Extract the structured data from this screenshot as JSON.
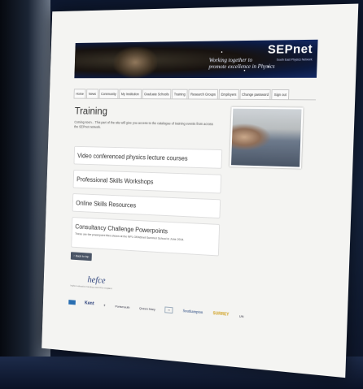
{
  "banner": {
    "logo": "SEPnet",
    "logo_sub": "South East Physics Network",
    "tagline_1": "Working together to",
    "tagline_2": "promote excellence in Physics"
  },
  "nav": {
    "tabs": [
      "Home",
      "News",
      "Community",
      "My Institution",
      "Graduate Schools",
      "Training",
      "Research Groups",
      "Employers",
      "Change password",
      "Sign out"
    ]
  },
  "main": {
    "title": "Training",
    "intro": "Coming soon... This part of the site will give you access to the catalogue of training events from across the SEPnet network.",
    "panels": [
      {
        "title": "Video conferenced physics lecture courses",
        "desc": ""
      },
      {
        "title": "Professional Skills Workshops",
        "desc": ""
      },
      {
        "title": "Online Skills Resources",
        "desc": ""
      },
      {
        "title": "Consultancy Challenge Powerpoints",
        "desc": "These are the powerpoint files shown at the NPL GRADnet Summer School in June 2014."
      }
    ],
    "back_to_top": "↑ Back to top"
  },
  "footer": {
    "hefce": "hefce",
    "hefce_sub": "higher education funding council for england",
    "logos": [
      "Kent",
      "Portsmouth",
      "Queen Mary",
      "Southampton",
      "SURREY",
      "UN"
    ]
  }
}
